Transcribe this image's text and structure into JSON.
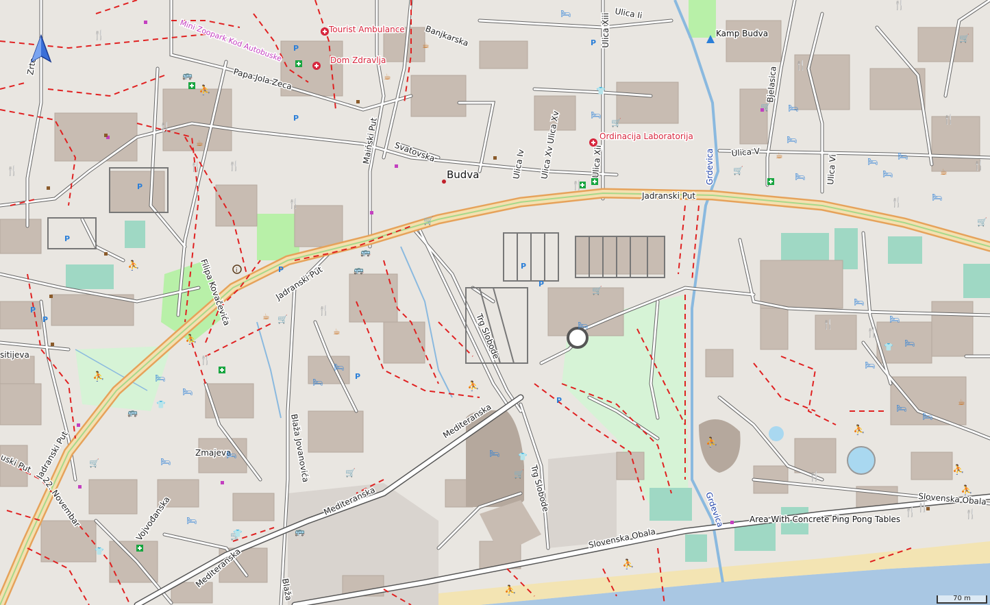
{
  "map": {
    "place_label": "Budva",
    "scale_label": "70 m",
    "colors": {
      "background": "#e9e6e1",
      "building": "#c8bcb2",
      "park": "#b8f0a8",
      "park_light": "#d6f3d6",
      "pitch": "#9fd8c4",
      "sea": "#a9c7e3",
      "beach": "#f3e4b3",
      "main_road_fill": "#f4e0b0",
      "main_road_edge": "#e6a25a",
      "footway": "#e02020",
      "water": "#8ab9df",
      "poi_red": "#d7263d",
      "poi_pink": "#c33fc0",
      "poi_blue": "#2b7fd8",
      "poi_orange": "#c86a14",
      "poi_green": "#18a540"
    },
    "streets": [
      "Papa Jola Zeca",
      "Banjkarska",
      "Ulica Ii",
      "Ulica Xiii",
      "Maiński Put",
      "Svatovska",
      "Ulica Iv",
      "Ulica Xv Ulica Xv",
      "Ulica Xii",
      "Jadranski Put",
      "Jadranski Put",
      "Jadranski Put",
      "Grdevica",
      "Grdevica",
      "Bjelasica",
      "Ulica V",
      "Ulica Vi",
      "Filipa Kovačevića",
      "Trg Slobode",
      "Trg Slobode",
      "Mediteranska",
      "Mediteranska",
      "Mediteranska",
      "Blaža Jovanovića",
      "Blaža",
      "Zmajeva",
      "Vojvođanska",
      "22. Novembar",
      "Slovenska Obala",
      "Slovenska Obala",
      "Zrte",
      "sitijeva",
      "uski Put"
    ],
    "pois": [
      "Tourist Ambulance",
      "Dom Zdravlja",
      "Mini Zoopark Kod Autobuske",
      "Ordinacija Laboratorija",
      "Kamp Budva",
      "Area With Concrete Ping Pong Tables"
    ]
  }
}
